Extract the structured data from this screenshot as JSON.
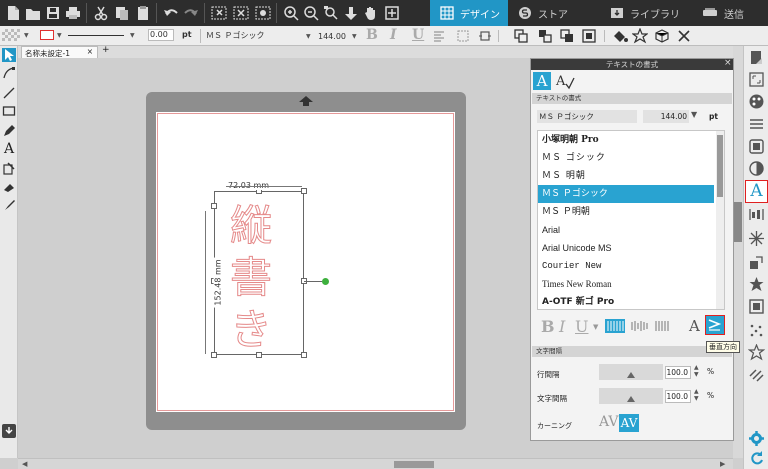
{
  "top_nav": {
    "tabs": [
      {
        "label": "デザイン",
        "active": true
      },
      {
        "label": "ストア",
        "active": false
      },
      {
        "label": "ライブラリ",
        "active": false
      },
      {
        "label": "送信",
        "active": false
      }
    ]
  },
  "options_bar": {
    "line_width": "0.00",
    "line_unit": "pt",
    "font_name": "ＭＳ Ｐゴシック",
    "font_size": "144.00",
    "bold": "B",
    "italic": "I",
    "underline": "U"
  },
  "document_tab": {
    "label": "名称未設定-1",
    "close": "×",
    "add": "+"
  },
  "canvas": {
    "width_dim": "72.03 mm",
    "height_dim": "152.48 mm",
    "vertical_text": [
      "縦",
      "書",
      "き"
    ]
  },
  "text_panel": {
    "title": "テキストの書式",
    "tab_font_icon": "A",
    "section_font": "テキストの書式",
    "font_value": "ＭＳ Ｐゴシック",
    "size_value": "144.00",
    "size_unit": "pt",
    "font_list": [
      "小塚明朝 Pro",
      "ＭＳ ゴシック",
      "ＭＳ 明朝",
      "ＭＳ Ｐゴシック",
      "ＭＳ Ｐ明朝",
      "Arial",
      "Arial Unicode MS",
      "Courier New",
      "Times New Roman",
      "A-OTF 新ゴ Pro"
    ],
    "selected_index": 3,
    "style_b": "B",
    "style_i": "I",
    "style_u": "U",
    "style_a": "A",
    "tooltip": "垂直方向",
    "section_spacing": "文字間隔",
    "line_spacing_label": "行間隔",
    "line_spacing_value": "100.0",
    "char_spacing_label": "文字間隔",
    "char_spacing_value": "100.0",
    "percent": "%",
    "kerning_label": "カーニング",
    "kerning_icon": "AV"
  },
  "colors": {
    "accent": "#29a3d1",
    "toolbar_bg": "#2d2d2d",
    "text_outline": "#e58a8a",
    "highlight_border": "#e02020"
  }
}
